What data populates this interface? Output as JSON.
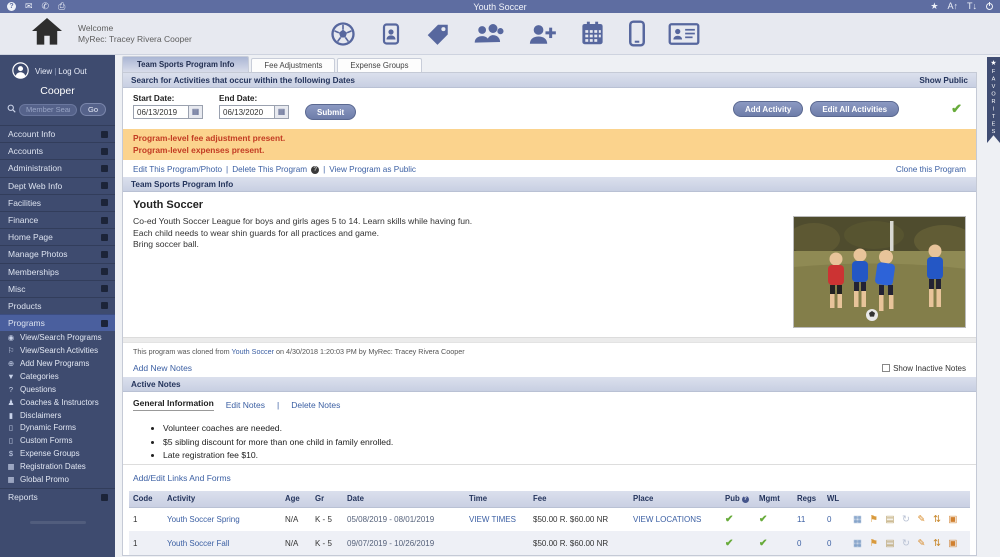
{
  "topbar": {
    "title": "Youth Soccer",
    "help_glyph": "?",
    "mail_glyph": "✉",
    "phone_glyph": "✆",
    "print_glyph": "⎙",
    "star_glyph": "★",
    "font_up": "A↑",
    "font_down": "T↓"
  },
  "header": {
    "welcome": "Welcome",
    "user": "MyRec: Tracey Rivera Cooper"
  },
  "sidebar": {
    "view": "View",
    "logout": "Log Out",
    "sep": "|",
    "user": "Cooper",
    "search_placeholder": "Member Search",
    "go": "Go",
    "search_glyph": "🔍",
    "items": [
      "Account Info",
      "Accounts",
      "Administration",
      "Dept Web Info",
      "Facilities",
      "Finance",
      "Home Page",
      "Manage Photos",
      "Memberships",
      "Misc",
      "Products",
      "Programs"
    ],
    "subitems": [
      {
        "glyph": "◉",
        "label": "View/Search Programs"
      },
      {
        "glyph": "⚐",
        "label": "View/Search Activities"
      },
      {
        "glyph": "⊕",
        "label": "Add New Programs"
      },
      {
        "glyph": "▼",
        "label": "Categories"
      },
      {
        "glyph": "?",
        "label": "Questions"
      },
      {
        "glyph": "♟",
        "label": "Coaches & Instructors"
      },
      {
        "glyph": "▮",
        "label": "Disclaimers"
      },
      {
        "glyph": "▯",
        "label": "Dynamic Forms"
      },
      {
        "glyph": "▯",
        "label": "Custom Forms"
      },
      {
        "glyph": "$",
        "label": "Expense Groups"
      },
      {
        "glyph": "▦",
        "label": "Registration Dates"
      },
      {
        "glyph": "▦",
        "label": "Global Promo"
      }
    ],
    "reports": "Reports"
  },
  "tabs": [
    "Team Sports Program Info",
    "Fee Adjustments",
    "Expense Groups"
  ],
  "search": {
    "title": "Search for Activities that occur within the following Dates",
    "show_public": "Show Public",
    "start_label": "Start Date:",
    "start_value": "06/13/2019",
    "end_label": "End Date:",
    "end_value": "06/13/2020",
    "submit": "Submit",
    "add_activity": "Add Activity",
    "edit_all": "Edit All Activities",
    "public_check": "✔",
    "calendar_glyph": "▦"
  },
  "notices": {
    "line1": "Program-level fee adjustment present.",
    "line2": "Program-level expenses present."
  },
  "links": {
    "edit": "Edit This Program/Photo",
    "sep": "|",
    "delete": "Delete This Program",
    "info_glyph": "?",
    "view_public": "View Program as Public",
    "clone": "Clone this Program"
  },
  "program": {
    "section": "Team Sports Program Info",
    "name": "Youth Soccer",
    "desc1": "Co-ed Youth Soccer League for boys and girls ages 5 to 14. Learn skills while having fun.",
    "desc2": "Each child needs to wear shin guards for all practices and game.",
    "desc3": "Bring soccer ball.",
    "cloned_prefix": "This program was cloned from",
    "cloned_link": "Youth Soccer",
    "cloned_suffix": "on 4/30/2018 1:20:03 PM by MyRec: Tracey Rivera Cooper"
  },
  "notes": {
    "add": "Add New Notes",
    "show_inactive": "Show Inactive Notes",
    "section": "Active Notes",
    "tab": "General Information",
    "edit": "Edit Notes",
    "delete": "Delete Notes",
    "sep": "|",
    "bullets": [
      "Volunteer coaches are needed.",
      "$5 sibling discount for more than one child in family enrolled.",
      "Late registration fee $10."
    ]
  },
  "links_forms": "Add/Edit Links And Forms",
  "activities": {
    "columns": {
      "code": "Code",
      "activity": "Activity",
      "age": "Age",
      "gr": "Gr",
      "date": "Date",
      "time": "Time",
      "fee": "Fee",
      "place": "Place",
      "pub": "Pub",
      "mgmt": "Mgmt",
      "regs": "Regs",
      "wl": "WL"
    },
    "pub_help_glyph": "?",
    "rows": [
      {
        "code": "1",
        "activity": "Youth Soccer Spring",
        "age": "N/A",
        "gr": "K - 5",
        "date": "05/08/2019 - 08/01/2019",
        "time": "VIEW TIMES",
        "fee": "$50.00 R. $60.00 NR",
        "place": "VIEW LOCATIONS",
        "pub": "✔",
        "mgmt": "✔",
        "regs": "11",
        "wl": "0"
      },
      {
        "code": "1",
        "activity": "Youth Soccer Fall",
        "age": "N/A",
        "gr": "K - 5",
        "date": "09/07/2019 - 10/26/2019",
        "time": "",
        "fee": "$50.00 R. $60.00 NR",
        "place": "",
        "pub": "✔",
        "mgmt": "✔",
        "regs": "0",
        "wl": "0"
      }
    ],
    "action_icons": [
      {
        "name": "roster-icon",
        "glyph": "▦"
      },
      {
        "name": "tag-icon",
        "glyph": "⚑"
      },
      {
        "name": "form-icon",
        "glyph": "▤"
      },
      {
        "name": "clone-activity-icon",
        "glyph": "↻"
      },
      {
        "name": "edit-pencil-icon",
        "glyph": "✎"
      },
      {
        "name": "reorder-icon",
        "glyph": "⇅"
      },
      {
        "name": "copy-icon",
        "glyph": "▣"
      }
    ]
  },
  "favorites": "FAVORITES",
  "colors": {
    "accent": "#5e6da1",
    "sidebar": "#3e4b6f",
    "active_item": "#4a5f9e",
    "notice_bg": "#fbd38d",
    "notice_text": "#c23b22",
    "link": "#3b5fa3",
    "check_green": "#67ab3a"
  }
}
